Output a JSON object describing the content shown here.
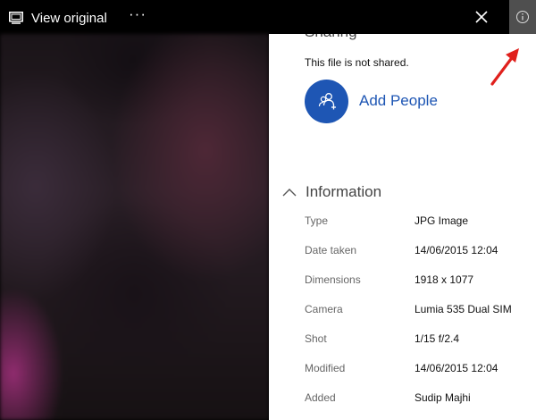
{
  "topbar": {
    "view_original_label": "View original",
    "more_label": "···"
  },
  "sharing": {
    "heading": "Sharing",
    "status_text": "This file is not shared.",
    "add_people_label": "Add People"
  },
  "information": {
    "heading": "Information",
    "rows": [
      {
        "key": "Type",
        "value": "JPG Image"
      },
      {
        "key": "Date taken",
        "value": "14/06/2015 12:04"
      },
      {
        "key": "Dimensions",
        "value": "1918 x 1077"
      },
      {
        "key": "Camera",
        "value": "Lumia 535 Dual SIM"
      },
      {
        "key": "Shot",
        "value": "1/15 f/2.4"
      },
      {
        "key": "Modified",
        "value": "14/06/2015 12:04"
      },
      {
        "key": "Added",
        "value": "Sudip Majhi"
      }
    ]
  },
  "icons": {
    "view_original": "view-original-icon",
    "close": "close-icon",
    "info": "info-icon",
    "add_people": "add-people-icon",
    "collapse": "chevron-up-icon",
    "annotation": "red-arrow"
  },
  "colors": {
    "accent": "#1e56b4",
    "info_button_bg": "#4f4f4f",
    "annotation_arrow": "#e0201c"
  }
}
